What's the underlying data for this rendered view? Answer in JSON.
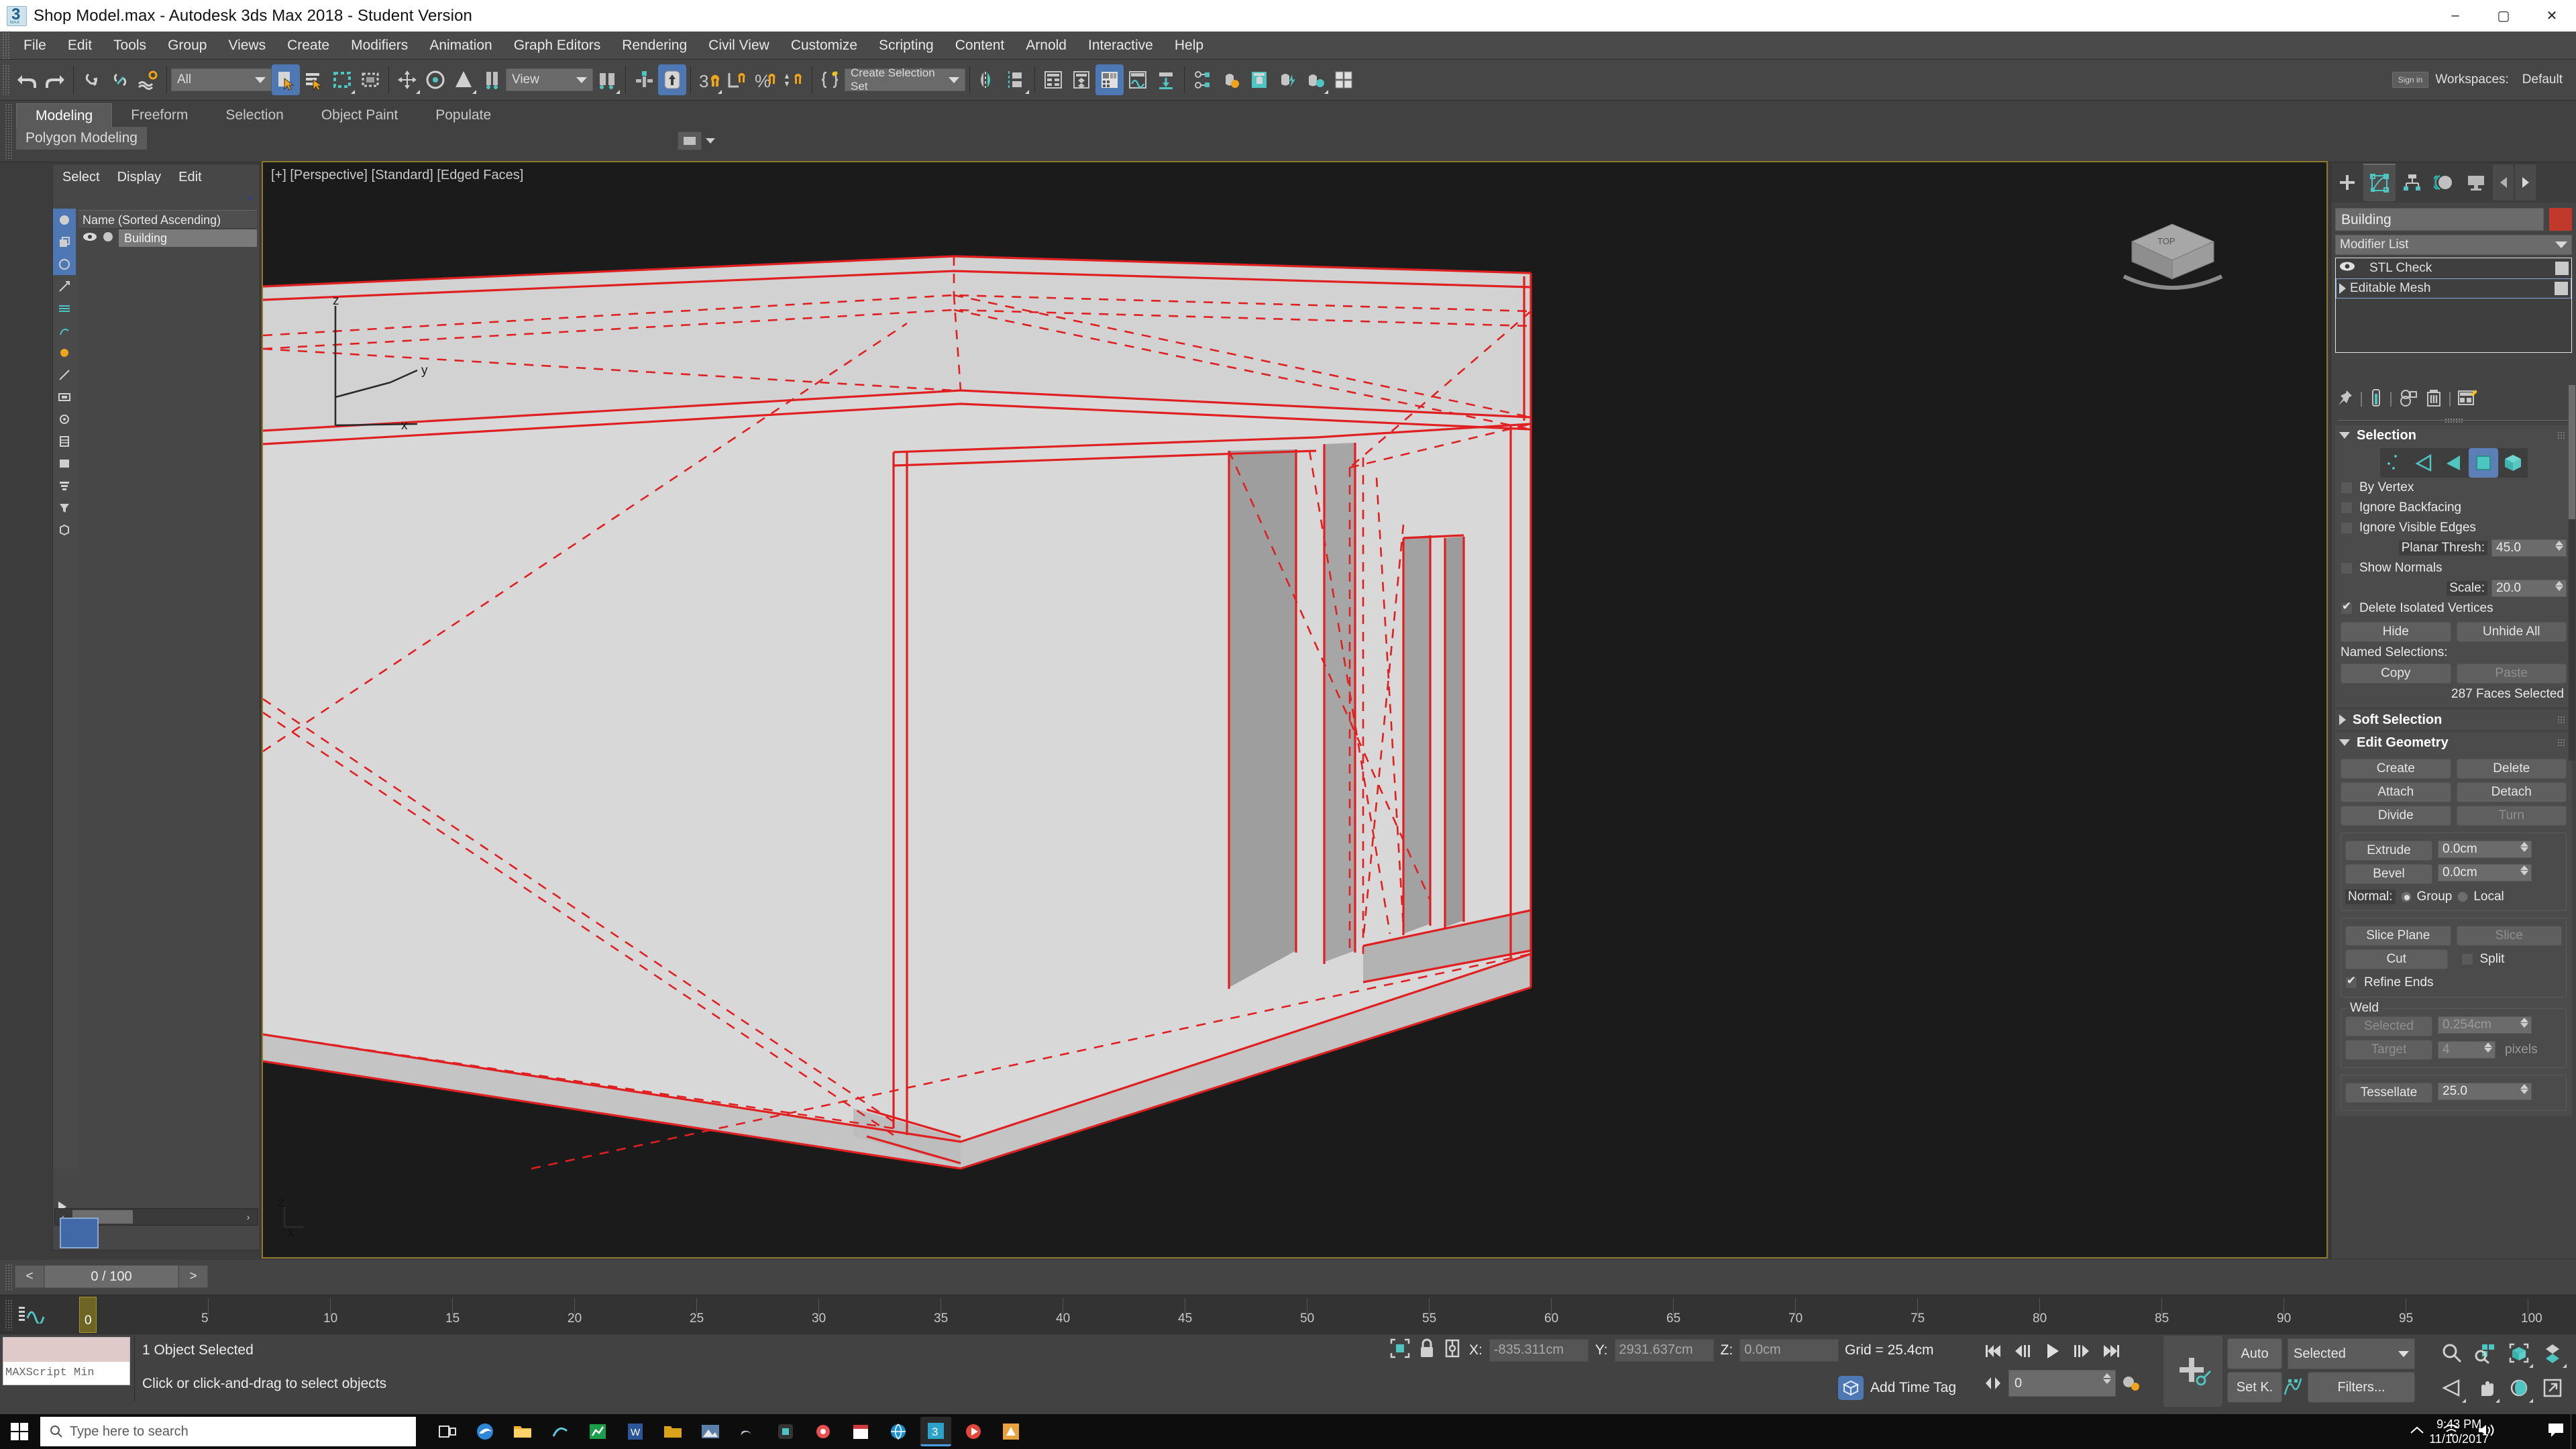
{
  "titlebar": {
    "title": "Shop Model.max - Autodesk 3ds Max 2018 - Student Version",
    "minimize": "–",
    "maximize": "▢",
    "close": "✕"
  },
  "menubar": {
    "items": [
      "File",
      "Edit",
      "Tools",
      "Group",
      "Views",
      "Create",
      "Modifiers",
      "Animation",
      "Graph Editors",
      "Rendering",
      "Civil View",
      "Customize",
      "Scripting",
      "Content",
      "Arnold",
      "Interactive",
      "Help"
    ]
  },
  "toolbar": {
    "selection_filter": "All",
    "reference_coord": "View",
    "named_selection_set": "Create Selection Set",
    "signin": "Sign in",
    "workspaces_label": "Workspaces:",
    "workspace_value": "Default"
  },
  "ribbon": {
    "tabs": [
      "Modeling",
      "Freeform",
      "Selection",
      "Object Paint",
      "Populate"
    ],
    "active_tab": "Modeling",
    "subtab": "Polygon Modeling"
  },
  "explorer": {
    "menu": [
      "Select",
      "Display",
      "Edit"
    ],
    "column_header": "Name (Sorted Ascending)",
    "rows": [
      {
        "name": "Building"
      }
    ]
  },
  "viewport": {
    "label": "[+] [Perspective] [Standard] [Edged Faces]",
    "axis_z": "z",
    "axis_y": "y",
    "axis_x": "x",
    "gizmo_z": "Z",
    "gizmo_x": "X",
    "viewcube_top": "TOP"
  },
  "command_panel": {
    "object_name": "Building",
    "object_color": "#c0392b",
    "accent_color": "#4ec5c1",
    "highlight_color": "#5c7fb8",
    "modifier_list_label": "Modifier List",
    "stack": [
      {
        "label": "STL Check",
        "icon": "eye-icon"
      },
      {
        "label": "Editable Mesh",
        "icon": "expand-arrow-icon"
      }
    ],
    "selection": {
      "title": "Selection",
      "sub_object_levels": [
        "vertex",
        "edge",
        "face",
        "polygon",
        "element"
      ],
      "active_level": "polygon",
      "by_vertex": {
        "label": "By Vertex",
        "checked": false
      },
      "ignore_backfacing": {
        "label": "Ignore Backfacing",
        "checked": false
      },
      "ignore_visible_edges": {
        "label": "Ignore Visible Edges",
        "checked": false
      },
      "planar_thresh": {
        "label": "Planar Thresh:",
        "value": "45.0"
      },
      "show_normals": {
        "label": "Show Normals",
        "checked": false
      },
      "scale": {
        "label": "Scale:",
        "value": "20.0"
      },
      "delete_isolated_vertices": {
        "label": "Delete Isolated Vertices",
        "checked": true
      },
      "hide": "Hide",
      "unhide_all": "Unhide All",
      "named_selections": "Named Selections:",
      "copy": "Copy",
      "paste": "Paste",
      "status": "287 Faces Selected"
    },
    "soft_selection": {
      "title": "Soft Selection",
      "collapsed": true
    },
    "edit_geometry": {
      "title": "Edit Geometry",
      "create": "Create",
      "delete": "Delete",
      "attach": "Attach",
      "detach": "Detach",
      "divide": "Divide",
      "turn": "Turn",
      "extrude": {
        "label": "Extrude",
        "value": "0.0cm"
      },
      "bevel": {
        "label": "Bevel",
        "value": "0.0cm"
      },
      "normal_label": "Normal:",
      "normal_group": "Group",
      "normal_local": "Local",
      "normal_selected": "Group",
      "slice_plane": "Slice Plane",
      "slice": "Slice",
      "cut": "Cut",
      "split": {
        "label": "Split",
        "checked": false
      },
      "refine_ends": {
        "label": "Refine Ends",
        "checked": true
      },
      "weld_title": "Weld",
      "weld_selected": "Selected",
      "weld_selected_value": "0.254cm",
      "weld_target": "Target",
      "weld_target_value": "4",
      "weld_pixels": "pixels",
      "tessellate": "Tessellate",
      "tessellate_value": "25.0"
    }
  },
  "timeslider": {
    "prev": "<",
    "next": ">",
    "frame": "0 / 100",
    "current_frame_label": "0",
    "ticks": [
      "0",
      "5",
      "10",
      "15",
      "20",
      "25",
      "30",
      "35",
      "40",
      "45",
      "50",
      "55",
      "60",
      "65",
      "70",
      "75",
      "80",
      "85",
      "90",
      "95",
      "100"
    ]
  },
  "statusbar": {
    "maxscript_placeholder": "MAXScript Min",
    "selection_status": "1 Object Selected",
    "prompt": "Click or click-and-drag to select objects",
    "x_label": "X:",
    "x_value": "-835.311cm",
    "y_label": "Y:",
    "y_value": "2931.637cm",
    "z_label": "Z:",
    "z_value": "0.0cm",
    "grid": "Grid = 25.4cm",
    "add_time_tag": "Add Time Tag",
    "frame_field": "0",
    "auto_key": "Auto",
    "set_key": "Set K.",
    "key_filter_mode": "Selected",
    "filters": "Filters..."
  },
  "taskbar": {
    "search_placeholder": "Type here to search",
    "clock_time": "9:43 PM",
    "clock_date": "11/10/2017",
    "apps": [
      "task-view",
      "edge-browser",
      "file-explorer",
      "misc-app",
      "chart-app",
      "word-app",
      "folder-app",
      "photos-app",
      "windows-app",
      "store-app",
      "weather-app",
      "calendar-app",
      "browser-app",
      "chrome-app",
      "max-app",
      "media-app",
      "autodesk-app"
    ],
    "active_app_badge": "3"
  }
}
